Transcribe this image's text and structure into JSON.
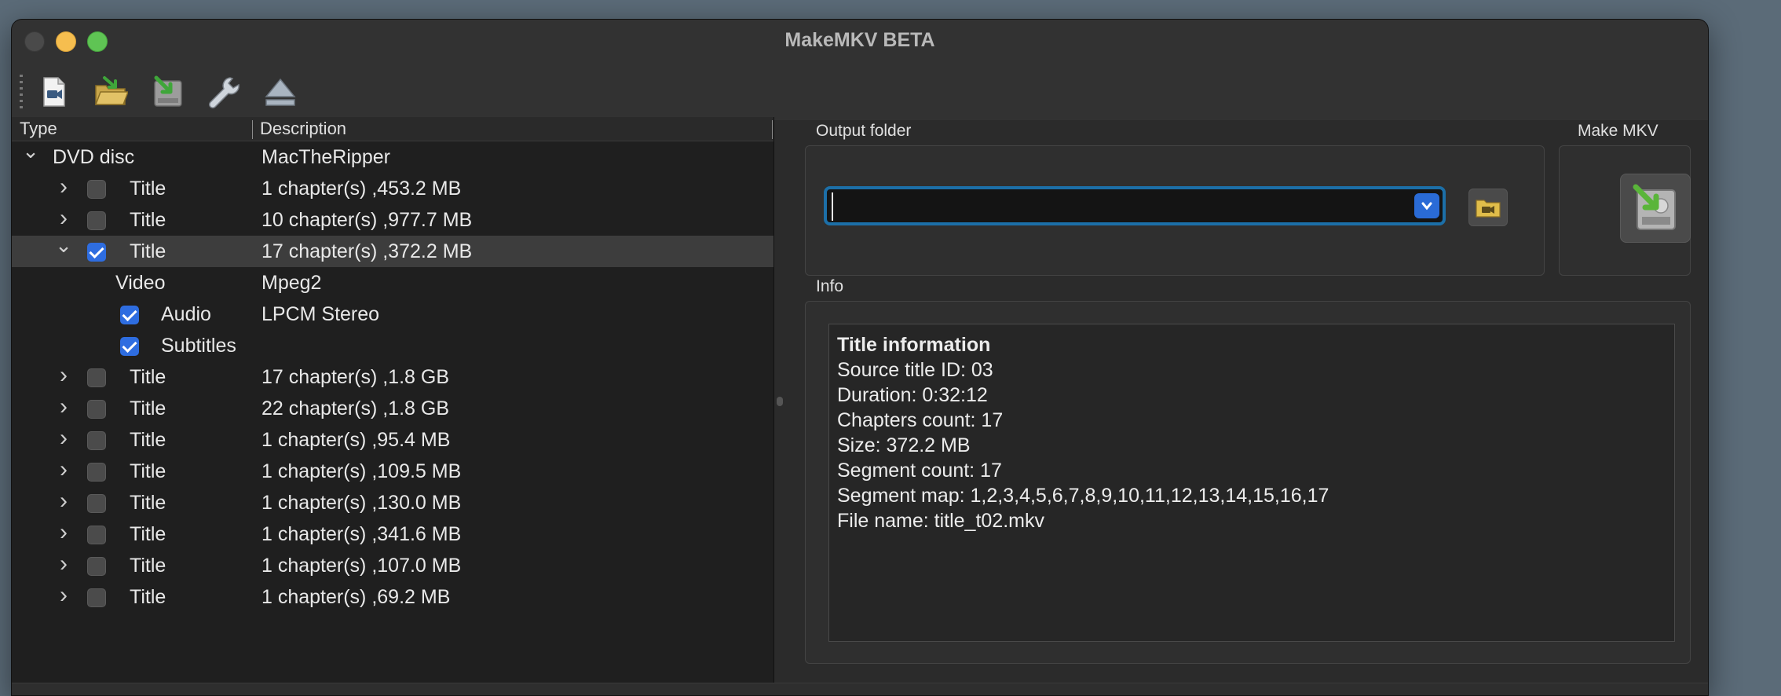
{
  "window": {
    "title": "MakeMKV BETA"
  },
  "toolbar": {
    "buttons": [
      {
        "name": "open-files",
        "icon": "open-file-icon"
      },
      {
        "name": "open-disc",
        "icon": "open-folder-icon"
      },
      {
        "name": "backup",
        "icon": "backup-icon"
      },
      {
        "name": "preferences",
        "icon": "wrench-icon"
      },
      {
        "name": "eject",
        "icon": "eject-icon"
      }
    ]
  },
  "tree": {
    "headers": {
      "type": "Type",
      "description": "Description"
    },
    "rows": [
      {
        "level": 0,
        "expander": "open",
        "checkbox": null,
        "type": "DVD disc",
        "desc": "MacTheRipper"
      },
      {
        "level": 1,
        "expander": "closed",
        "checkbox": false,
        "type": "Title",
        "desc": "1 chapter(s) ,453.2 MB"
      },
      {
        "level": 1,
        "expander": "closed",
        "checkbox": false,
        "type": "Title",
        "desc": "10 chapter(s) ,977.7 MB"
      },
      {
        "level": 1,
        "expander": "open",
        "checkbox": true,
        "type": "Title",
        "desc": "17 chapter(s) ,372.2 MB",
        "selected": true
      },
      {
        "level": 2,
        "expander": null,
        "checkbox": null,
        "type": "Video",
        "desc": "Mpeg2"
      },
      {
        "level": 2,
        "expander": null,
        "checkbox": true,
        "type": "Audio",
        "desc": "LPCM Stereo"
      },
      {
        "level": 2,
        "expander": null,
        "checkbox": true,
        "type": "Subtitles",
        "desc": ""
      },
      {
        "level": 1,
        "expander": "closed",
        "checkbox": false,
        "type": "Title",
        "desc": "17 chapter(s) ,1.8 GB"
      },
      {
        "level": 1,
        "expander": "closed",
        "checkbox": false,
        "type": "Title",
        "desc": "22 chapter(s) ,1.8 GB"
      },
      {
        "level": 1,
        "expander": "closed",
        "checkbox": false,
        "type": "Title",
        "desc": "1 chapter(s) ,95.4 MB"
      },
      {
        "level": 1,
        "expander": "closed",
        "checkbox": false,
        "type": "Title",
        "desc": "1 chapter(s) ,109.5 MB"
      },
      {
        "level": 1,
        "expander": "closed",
        "checkbox": false,
        "type": "Title",
        "desc": "1 chapter(s) ,130.0 MB"
      },
      {
        "level": 1,
        "expander": "closed",
        "checkbox": false,
        "type": "Title",
        "desc": "1 chapter(s) ,341.6 MB"
      },
      {
        "level": 1,
        "expander": "closed",
        "checkbox": false,
        "type": "Title",
        "desc": "1 chapter(s) ,107.0 MB"
      },
      {
        "level": 1,
        "expander": "closed",
        "checkbox": false,
        "type": "Title",
        "desc": "1 chapter(s) ,69.2 MB"
      }
    ]
  },
  "output": {
    "label": "Output folder",
    "value": "",
    "browse_icon": "folder-video-icon"
  },
  "makemkv": {
    "label": "Make MKV",
    "icon": "make-mkv-icon"
  },
  "info": {
    "label": "Info",
    "heading": "Title information",
    "lines": [
      "Source title ID: 03",
      "Duration: 0:32:12",
      "Chapters count: 17",
      "Size: 372.2 MB",
      "Segment count: 17",
      "Segment map: 1,2,3,4,5,6,7,8,9,10,11,12,13,14,15,16,17",
      "File name: title_t02.mkv"
    ]
  },
  "colors": {
    "accent": "#2e6de0",
    "focus": "#1c6fa8",
    "background": "#2b2b2b"
  }
}
